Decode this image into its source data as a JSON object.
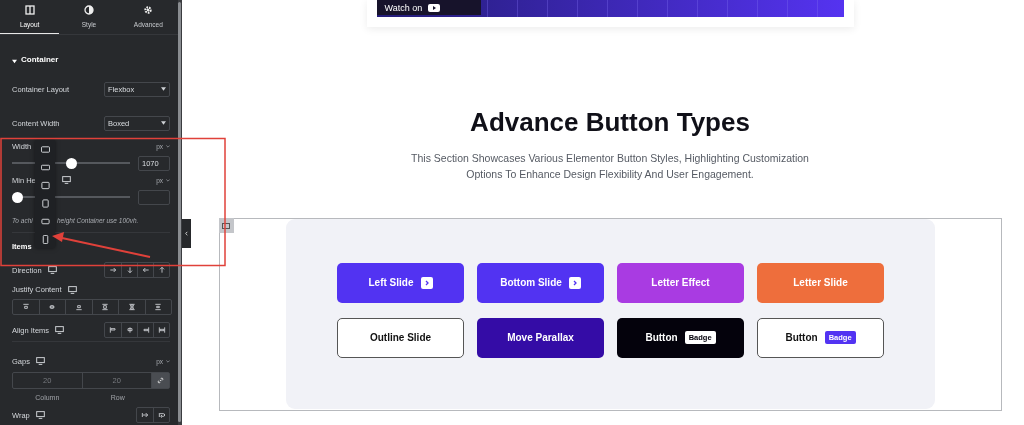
{
  "panel": {
    "tabs": [
      {
        "label": "Layout",
        "kind": "layout",
        "selected": true
      },
      {
        "label": "Style",
        "kind": "style",
        "selected": false
      },
      {
        "label": "Advanced",
        "kind": "advanced",
        "selected": false
      }
    ],
    "section": {
      "title": "Container",
      "expanded": true
    },
    "controls": [
      {
        "kind": "select",
        "label": "Container Layout",
        "value": "Flexbox"
      },
      {
        "kind": "select",
        "label": "Content Width",
        "value": "Boxed"
      },
      {
        "kind": "slider",
        "label": "Width",
        "unit": "px",
        "level": 0.5,
        "value": "1070",
        "device_icon": false
      },
      {
        "kind": "slider",
        "label": "Min He",
        "unit": "px",
        "level": 0,
        "device_icon": true
      },
      {
        "kind": "hint",
        "parts": [
          "To achi",
          "height Container use 100vh."
        ]
      },
      {
        "kind": "heading",
        "label": "Items"
      },
      {
        "kind": "direction",
        "label": "Direction"
      },
      {
        "kind": "justify",
        "label": "Justify Content"
      },
      {
        "kind": "align",
        "label": "Align Items"
      },
      {
        "kind": "gaps",
        "label": "Gaps",
        "unit": "px",
        "fields": [
          {
            "placeholder": "20",
            "caption": "Column"
          },
          {
            "placeholder": "20",
            "caption": "Row"
          }
        ]
      },
      {
        "kind": "wrap",
        "label": "Wrap"
      }
    ]
  },
  "video": {
    "label": "Watch on"
  },
  "section_heading": "Advance Button Types",
  "section_text": "This Section Showcases Various Elementor Button Styles, Highlighting Customization Options To Enhance Design Flexibility And User Engagement.",
  "buttons": [
    {
      "label": "Left Slide",
      "kind": "arrow",
      "color": "#5233f2"
    },
    {
      "label": "Bottom Slide",
      "kind": "arrow",
      "color": "#5233f2"
    },
    {
      "label": "Letter Effect",
      "kind": "plain",
      "color": "#a93be2"
    },
    {
      "label": "Letter Slide",
      "kind": "plain",
      "color": "#ee6e3c"
    },
    {
      "label": "Outline Slide",
      "kind": "outline",
      "color": "#555555"
    },
    {
      "label": "Move Parallax",
      "kind": "plain",
      "color": "#340ca6"
    },
    {
      "label": "Button",
      "kind": "badge",
      "color": "#04020c",
      "badge": "Badge"
    },
    {
      "label": "Button",
      "kind": "outline-badge",
      "color": "#555555",
      "badge": "Badge"
    }
  ]
}
